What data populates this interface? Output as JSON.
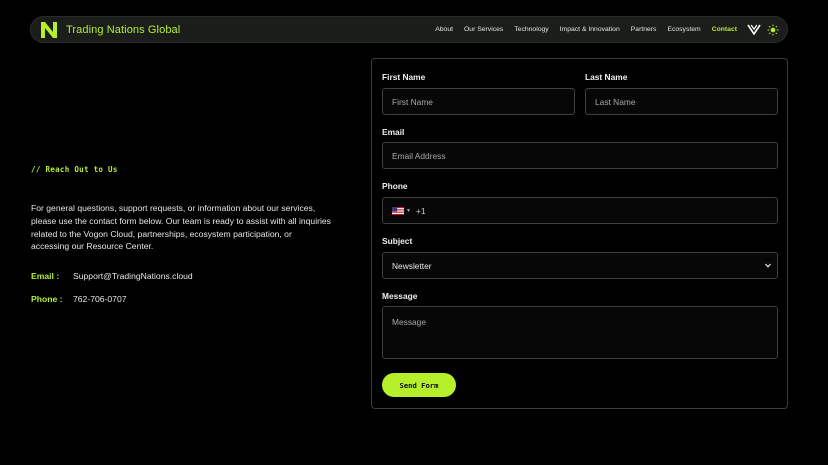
{
  "nav": {
    "brand": "Trading Nations Global",
    "items": [
      {
        "label": "About",
        "active": false
      },
      {
        "label": "Our Services",
        "active": false
      },
      {
        "label": "Technology",
        "active": false
      },
      {
        "label": "Impact & Innovation",
        "active": false
      },
      {
        "label": "Partners",
        "active": false
      },
      {
        "label": "Ecosystem",
        "active": false
      },
      {
        "label": "Contact",
        "active": true
      }
    ],
    "icons": [
      "logo-n-icon",
      "v-logo-icon",
      "sun-icon"
    ]
  },
  "left": {
    "kicker": "// Reach Out to Us",
    "intro": "For general questions, support requests, or information about our services, please use the contact form below. Our team is ready to assist with all inquiries related to the Vogon Cloud, partnerships, ecosystem participation, or accessing our Resource Center.",
    "email_label": "Email :",
    "email_value": "Support@TradingNations.cloud",
    "phone_label": "Phone :",
    "phone_value": "762-706-0707"
  },
  "form": {
    "first_name_label": "First Name",
    "first_name_placeholder": "First Name",
    "last_name_label": "Last Name",
    "last_name_placeholder": "Last Name",
    "email_label": "Email",
    "email_placeholder": "Email Address",
    "phone_label": "Phone",
    "phone_dial": "+1",
    "subject_label": "Subject",
    "subject_value": "Newsletter",
    "message_label": "Message",
    "message_placeholder": "Message",
    "submit_label": "Send Form"
  },
  "colors": {
    "accent": "#b6f02a",
    "background": "#000000",
    "nav_bg": "#1b1d1a"
  }
}
